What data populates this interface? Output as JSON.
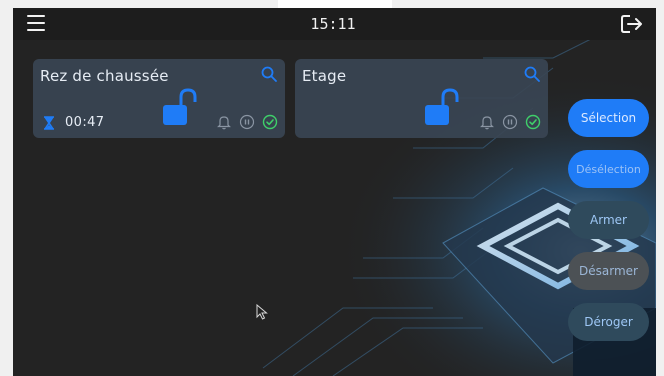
{
  "header": {
    "time": "15:11",
    "menu_icon": "hamburger-menu-icon",
    "logout_icon": "logout-icon"
  },
  "zones": [
    {
      "name": "Rez de chaussée",
      "timer": "00:47",
      "lock_state": "unlocked",
      "icons": [
        "search-icon",
        "unlock-icon",
        "hourglass-icon",
        "bell-icon",
        "pause-icon",
        "check-circle-icon"
      ]
    },
    {
      "name": "Etage",
      "lock_state": "unlocked",
      "icons": [
        "search-icon",
        "unlock-icon",
        "bell-icon",
        "pause-icon",
        "check-circle-icon"
      ]
    }
  ],
  "actions": {
    "selection": "Sélection",
    "deselection": "Désélection",
    "armer": "Armer",
    "desarmer": "Désarmer",
    "deroger": "Déroger"
  },
  "colors": {
    "accent_blue": "#1f7cf7",
    "card_bg": "#3a4554",
    "ok_green": "#3fcf6a"
  }
}
